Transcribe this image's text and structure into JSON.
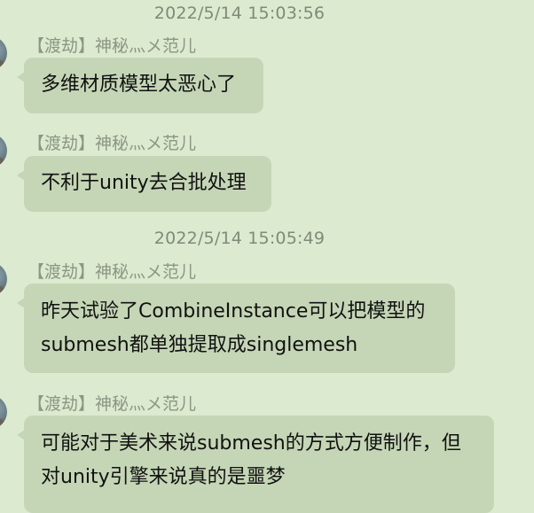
{
  "chat": {
    "timestamps": [
      "2022/5/14 15:03:56",
      "2022/5/14 15:05:49"
    ],
    "sender_name": "【渡劫】神秘灬メ范儿",
    "messages": [
      {
        "lines": [
          "多维材质模型太恶心了"
        ]
      },
      {
        "lines": [
          "不利于unity去合批处理"
        ]
      },
      {
        "lines": [
          "昨天试验了CombineInstance可以把模型的",
          "submesh都单独提取成singlemesh"
        ]
      },
      {
        "lines": [
          "可能对于美术来说submesh的方式方便制作，但",
          "对unity引擎来说真的是噩梦"
        ]
      }
    ]
  }
}
